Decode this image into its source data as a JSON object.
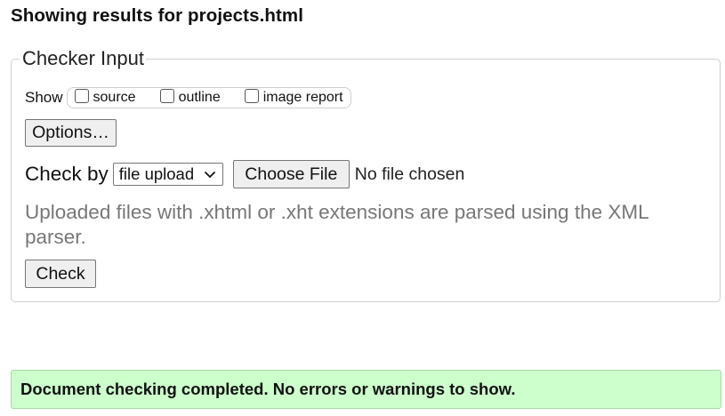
{
  "page": {
    "title": "Showing results for projects.html"
  },
  "checker": {
    "legend": "Checker Input",
    "show_label": "Show",
    "show_options": [
      {
        "label": "source",
        "checked": false
      },
      {
        "label": "outline",
        "checked": false
      },
      {
        "label": "image report",
        "checked": false
      }
    ],
    "options_button": "Options…",
    "check_by_label": "Check by",
    "check_by_selected": "file upload",
    "choose_file_button": "Choose File",
    "file_status": "No file chosen",
    "hint": "Uploaded files with .xhtml or .xht extensions are parsed using the XML parser.",
    "check_button": "Check"
  },
  "status": {
    "message": "Document checking completed. No errors or warnings to show.",
    "background": "#ccffcc"
  },
  "icons": {
    "select_arrow": "chevron-down-icon"
  }
}
